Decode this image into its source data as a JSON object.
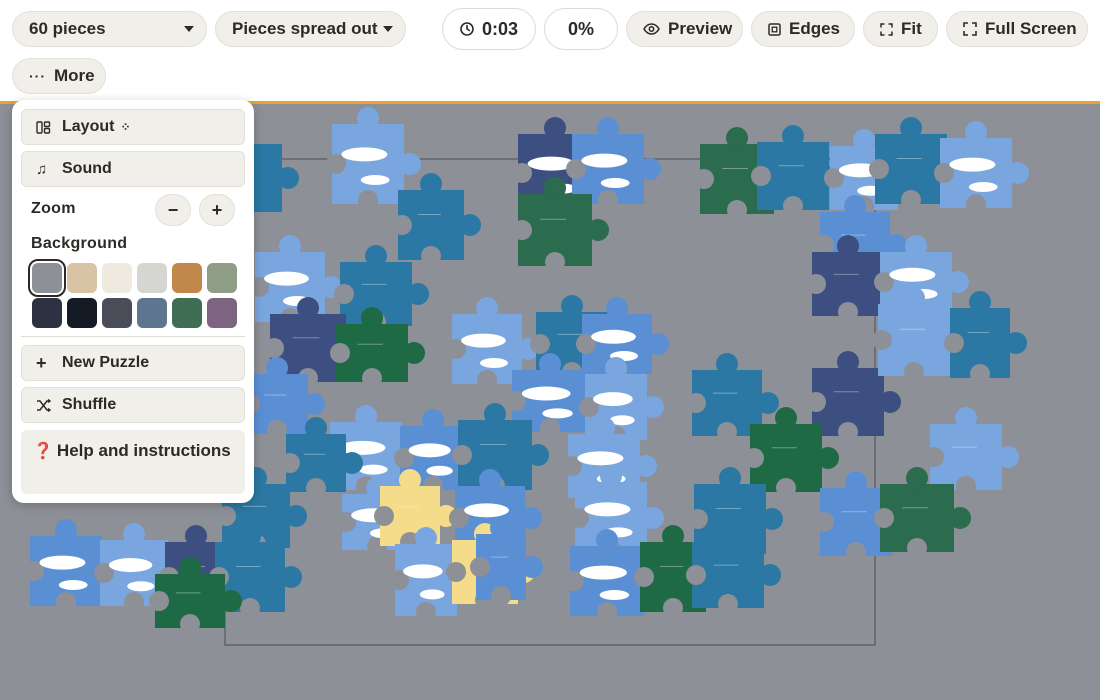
{
  "toolbar": {
    "pieces_select": "60 pieces",
    "layout_select": "Pieces spread out",
    "timer": "0:03",
    "progress": "0%",
    "preview": "Preview",
    "edges": "Edges",
    "fit": "Fit",
    "full_screen": "Full Screen",
    "more": "More"
  },
  "panel": {
    "layout": "Layout",
    "sound": "Sound",
    "zoom_label": "Zoom",
    "zoom_out": "−",
    "zoom_in": "+",
    "background_label": "Background",
    "background_colors": [
      "#8d9097",
      "#d8c3a5",
      "#efe9df",
      "#d5d5d2",
      "#c2874a",
      "#8f9c86",
      "#2d3242",
      "#151b25",
      "#4a4d57",
      "#5e7590",
      "#3f6e55",
      "#7d6480"
    ],
    "selected_background": "#8d9097",
    "new_puzzle": "New Puzzle",
    "shuffle": "Shuffle",
    "help_icon": "❓",
    "help": "Help and instructions"
  },
  "icons": {
    "clock": "clock-icon",
    "eye": "eye-icon",
    "edges": "edges-icon",
    "fit": "fit-icon",
    "fullscreen": "fullscreen-icon",
    "more": "more-icon",
    "layout": "layout-icon",
    "sound": "music-note-icon",
    "plus": "plus-icon",
    "shuffle": "shuffle-icon"
  },
  "colors": {
    "accent_border": "#f0a030",
    "board_background": "#8d9097",
    "pill_background": "#f1efe9"
  }
}
